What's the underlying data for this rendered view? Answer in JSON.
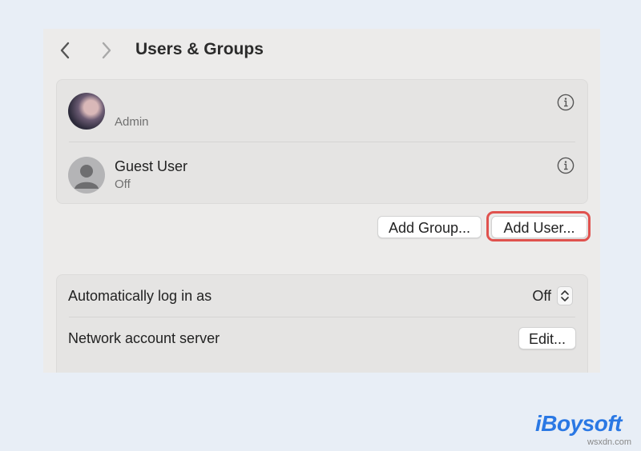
{
  "window": {
    "title": "Users & Groups"
  },
  "users": [
    {
      "name": "",
      "status": "Admin",
      "avatar": "photo"
    },
    {
      "name": "Guest User",
      "status": "Off",
      "avatar": "guest-user-icon"
    }
  ],
  "actions": {
    "add_group_label": "Add Group...",
    "add_user_label": "Add User..."
  },
  "settings": {
    "auto_login_label": "Automatically log in as",
    "auto_login_value": "Off",
    "network_server_label": "Network account server",
    "edit_label": "Edit..."
  },
  "branding": {
    "logo_text": "iBoysoft",
    "watermark": "wsxdn.com"
  },
  "colors": {
    "highlight": "#e0524e",
    "brand": "#2a78e4",
    "window_bg": "#ecebea",
    "page_bg": "#e8eef6"
  }
}
